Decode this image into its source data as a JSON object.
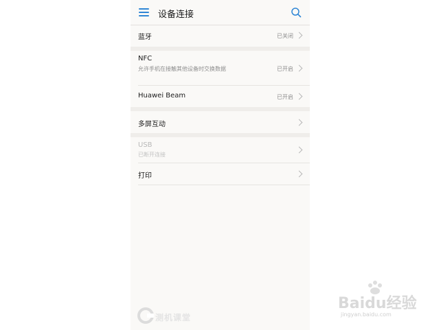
{
  "header": {
    "title": "设备连接"
  },
  "settings": {
    "bluetooth": {
      "label": "蓝牙",
      "status": "已关闭"
    },
    "nfc": {
      "label": "NFC",
      "description": "允许手机在接触其他设备时交换数据",
      "status": "已开启"
    },
    "huawei_beam": {
      "label": "Huawei Beam",
      "status": "已开启"
    },
    "multi_screen": {
      "label": "多屏互动"
    },
    "usb": {
      "label": "USB",
      "description": "已断开连接"
    },
    "print": {
      "label": "打印"
    }
  },
  "watermarks": {
    "left_logo_text": "测机课堂",
    "baidu_brand": "Baidu经验",
    "baidu_url": "jingyan.baidu.com"
  },
  "colors": {
    "accent": "#2f86d5",
    "background": "#faf9f7",
    "separator": "#efedea"
  },
  "icons": [
    "menu-icon",
    "search-icon",
    "chevron-right-icon"
  ]
}
